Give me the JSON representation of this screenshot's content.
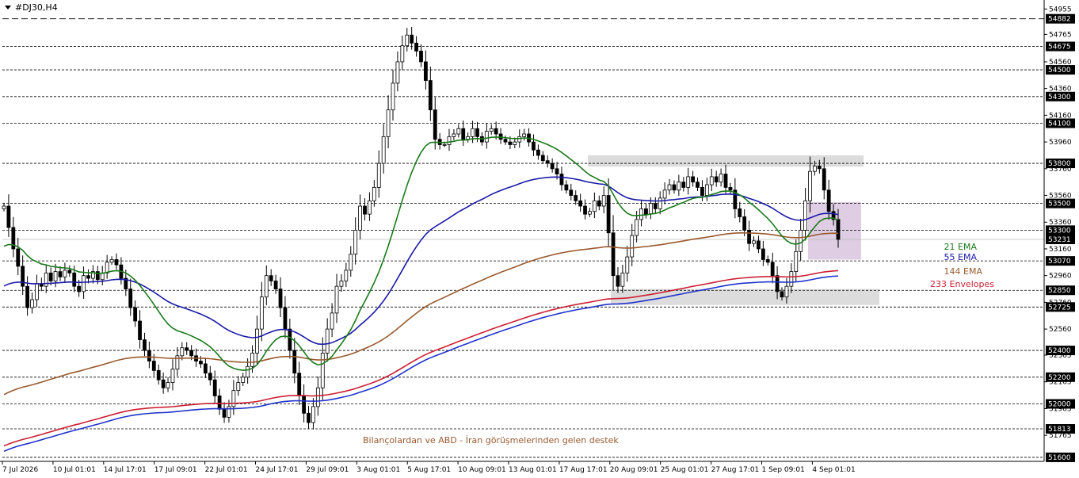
{
  "window": {
    "title": "#DJ30,H4"
  },
  "colors": {
    "background": "#ffffff",
    "candle": "#000000",
    "ema21": "#1a7a1a",
    "ema55": "#1a1aa8",
    "ema144": "#9a5a2e",
    "envelope_upper": "#cc1f33",
    "envelope_lower": "#1f33cc",
    "zone": "#d8d8d8",
    "zone_pink": "#d6c0dc",
    "grid": "#000000",
    "price_tag_bg": "#000000",
    "price_tag_text": "#ffffff"
  },
  "chart_data": {
    "type": "candlestick",
    "symbol": "#DJ30",
    "timeframe": "H4",
    "ylim": [
      51570,
      54975
    ],
    "current_price": "53231",
    "x_ticks": [
      "7 Jul 2026",
      "10 Jul 01:01",
      "14 Jul 17:01",
      "17 Jul 09:01",
      "22 Jul 01:01",
      "24 Jul 17:01",
      "29 Jul 09:01",
      "3 Aug 01:01",
      "5 Aug 17:01",
      "10 Aug 09:01",
      "13 Aug 01:01",
      "17 Aug 17:01",
      "20 Aug 09:01",
      "25 Aug 01:01",
      "27 Aug 17:01",
      "1 Sep 09:01",
      "4 Sep 01:01"
    ],
    "y_ticks": [
      "54955",
      "54765",
      "54560",
      "54360",
      "54160",
      "53960",
      "53760",
      "53560",
      "53360",
      "53160",
      "52960",
      "52760",
      "52560",
      "52365",
      "52165",
      "51965",
      "51765"
    ],
    "levels": [
      "54882",
      "54675",
      "54500",
      "54300",
      "54100",
      "53800",
      "53500",
      "53300",
      "53070",
      "52850",
      "52725",
      "52400",
      "52200",
      "52000",
      "51813",
      "51600"
    ],
    "zones": [
      {
        "from": 53775,
        "to": 53860
      },
      {
        "from": 52740,
        "to": 52860
      },
      {
        "from": 53080,
        "to": 53510
      }
    ],
    "closes": [
      53480,
      53320,
      53160,
      53030,
      52880,
      52720,
      52780,
      52900,
      52880,
      52980,
      52920,
      52990,
      52950,
      53000,
      52980,
      52880,
      52840,
      52960,
      52940,
      52990,
      52930,
      52980,
      53060,
      53080,
      53040,
      52940,
      52860,
      52720,
      52620,
      52480,
      52400,
      52320,
      52250,
      52180,
      52120,
      52160,
      52260,
      52360,
      52420,
      52400,
      52360,
      52320,
      52300,
      52230,
      52180,
      52060,
      51960,
      51900,
      51980,
      52100,
      52160,
      52200,
      52280,
      52380,
      52560,
      52800,
      52960,
      52920,
      52860,
      52720,
      52560,
      52400,
      52230,
      52060,
      51930,
      51860,
      51980,
      52120,
      52380,
      52560,
      52680,
      52880,
      52920,
      53000,
      53120,
      53300,
      53480,
      53420,
      53520,
      53620,
      53800,
      54000,
      54200,
      54400,
      54560,
      54680,
      54760,
      54700,
      54640,
      54560,
      54420,
      54200,
      53980,
      53940,
      53940,
      54000,
      54020,
      54060,
      53980,
      54000,
      54060,
      54000,
      53960,
      54040,
      54060,
      54020,
      53980,
      53960,
      53940,
      53960,
      54000,
      54020,
      53960,
      53900,
      53860,
      53820,
      53800,
      53760,
      53720,
      53640,
      53600,
      53560,
      53520,
      53480,
      53420,
      53440,
      53520,
      53480,
      53560,
      53280,
      52960,
      52880,
      52980,
      53100,
      53260,
      53380,
      53460,
      53420,
      53500,
      53460,
      53540,
      53600,
      53640,
      53600,
      53660,
      53620,
      53700,
      53660,
      53620,
      53560,
      53640,
      53700,
      53660,
      53720,
      53620,
      53600,
      53460,
      53400,
      53300,
      53200,
      53220,
      53160,
      53080,
      53060,
      52960,
      52840,
      52800,
      52880,
      52990,
      53140,
      53300,
      53520,
      53740,
      53780,
      53760,
      53600,
      53440,
      53380,
      53231
    ]
  },
  "indicators": {
    "ema21_label": "21 EMA",
    "ema55_label": "55 EMA",
    "ema144_label": "144 EMA",
    "envelope_label": "233 Envelopes"
  },
  "annotation": {
    "text": "Bilançolardan ve ABD - İran görüşmelerinden gelen destek"
  }
}
